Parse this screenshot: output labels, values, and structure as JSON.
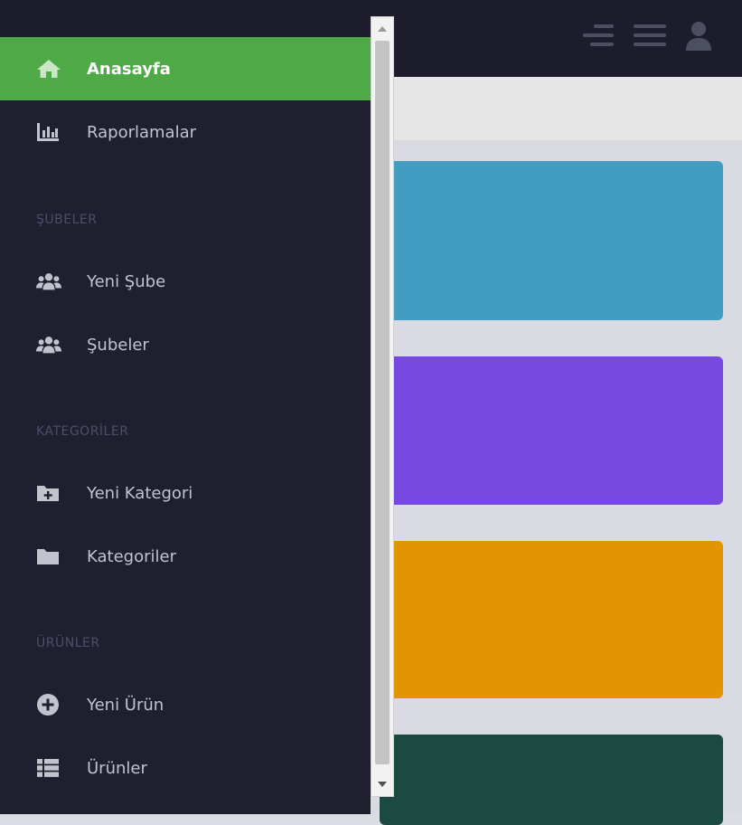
{
  "colors": {
    "topbar": "#1c1c2c",
    "sidebar": "#1f1f2f",
    "active_item": "#4daa47",
    "card_1": "#439dc0",
    "card_2": "#7749e0",
    "card_3": "#e39401",
    "card_4": "#1b4b40"
  },
  "topbar": {
    "icons": [
      "collapse-menu-icon",
      "hamburger-menu-icon",
      "user-icon"
    ]
  },
  "sidebar": {
    "items": [
      {
        "label": "Anasayfa",
        "icon": "home-icon",
        "active": true
      },
      {
        "label": "Raporlamalar",
        "icon": "chart-bar-icon"
      },
      {
        "label": "Yeni Şube",
        "icon": "users-icon"
      },
      {
        "label": "Şubeler",
        "icon": "users-icon"
      },
      {
        "label": "Yeni Kategori",
        "icon": "folder-plus-icon"
      },
      {
        "label": "Kategoriler",
        "icon": "folder-icon"
      },
      {
        "label": "Yeni Ürün",
        "icon": "plus-circle-icon"
      },
      {
        "label": "Ürünler",
        "icon": "list-icon"
      }
    ],
    "sections": {
      "subeler": "ŞUBELER",
      "kategoriler": "KATEGORİLER",
      "urunler": "ÜRÜNLER"
    }
  }
}
